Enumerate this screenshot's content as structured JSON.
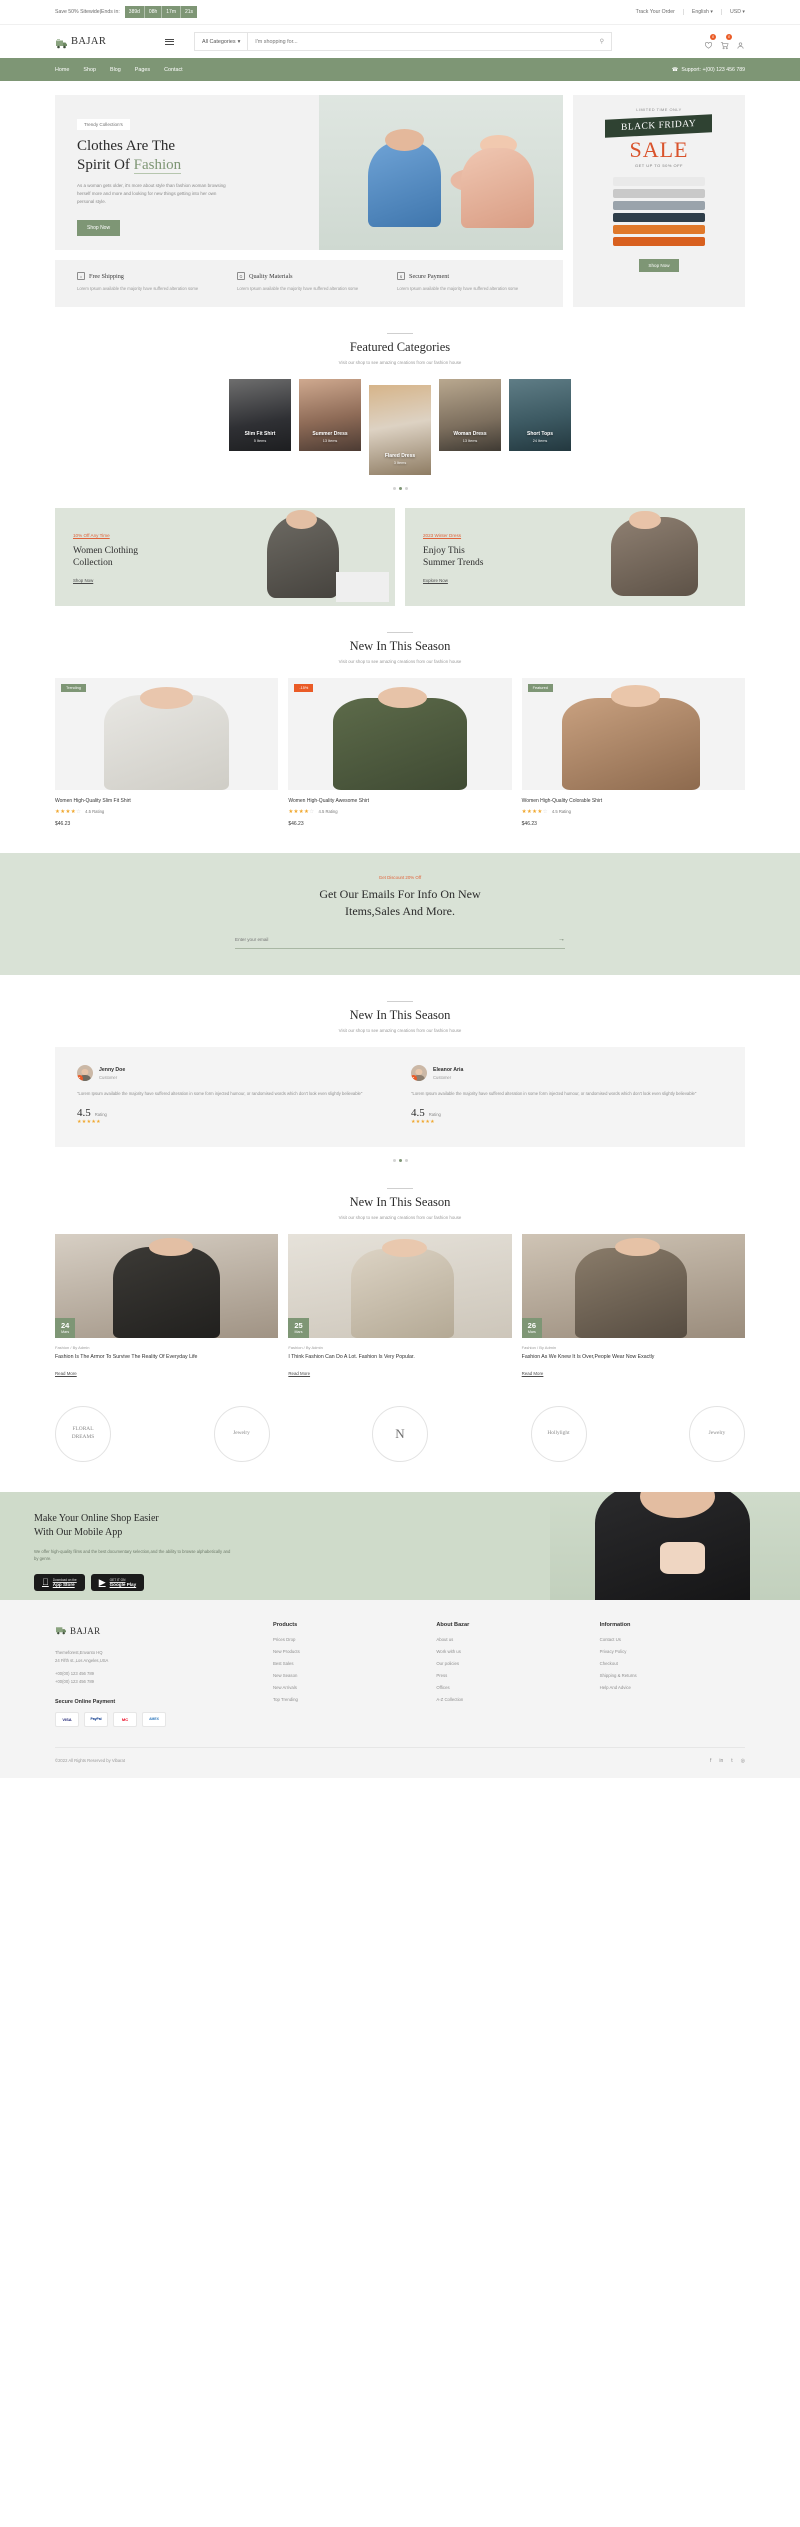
{
  "topbar": {
    "promo_text": "Save 50% Sitewide|Ends in:",
    "countdown": [
      "389d",
      "08h",
      "17m",
      "21s"
    ],
    "track": "Track Your Order",
    "language": "English",
    "currency": "USD"
  },
  "header": {
    "brand": "BAJAR",
    "category_select": "All Categories",
    "search_placeholder": "I'm shopping for...",
    "wishlist_count": "0",
    "cart_count": "0"
  },
  "nav": {
    "links": [
      "Home",
      "Shop",
      "Blog",
      "Pages",
      "Contact"
    ],
    "support": "Support: +(00) 123 456 789"
  },
  "hero": {
    "chip": "Trendy Collection's",
    "title_line1": "Clothes Are The",
    "title_line2_pre": "Spirit Of ",
    "title_line2_accent": "Fashion",
    "paragraph": "As a woman gets older, it's more about style than fashion woman browsing herself more and more and looking for new things getting into her own personal style.",
    "cta": "Shop Now"
  },
  "features": [
    {
      "icon": "bag-icon",
      "glyph": "⌂",
      "title": "Free Shipping",
      "text": "Lorem Ipsum available the majority have suffered alteration some"
    },
    {
      "icon": "tshirt-icon",
      "glyph": "⍉",
      "title": "Quality Materials",
      "text": "Lorem Ipsum available the majority have suffered alteration some"
    },
    {
      "icon": "money-icon",
      "glyph": "$",
      "title": "Secure Payment",
      "text": "Lorem Ipsum available the majority have suffered alteration some"
    }
  ],
  "side_banner": {
    "eyebrow": "LIMITED TIME ONLY",
    "band": "BLACK FRIDAY",
    "sale": "SALE",
    "sub": "GET UP TO 50% OFF",
    "cta": "Shop Now"
  },
  "categories_section": {
    "title": "Featured Categories",
    "subtitle": "Visit our shop to see amazing creations from our fashion house",
    "items": [
      {
        "name": "Slim Fit Shirt",
        "count": "5 Items"
      },
      {
        "name": "Summer Dress",
        "count": "13 Items"
      },
      {
        "name": "Flared Dress",
        "count": "3 Items"
      },
      {
        "name": "Woman Dress",
        "count": "13 Items"
      },
      {
        "name": "Short Tops",
        "count": "24 Items"
      }
    ]
  },
  "promos": [
    {
      "tag": "10% Off Any Time",
      "title_line1": "Women Clothing",
      "title_line2": "Collection",
      "link": "Shop Now"
    },
    {
      "tag": "2023 Winter Dress",
      "title_line1": "Enjoy This",
      "title_line2": "Summer Trends",
      "link": "Explore Now"
    }
  ],
  "new_season": {
    "title": "New In This Season",
    "subtitle": "Visit our shop to see amazing creations from our fashion house"
  },
  "products": [
    {
      "flag": "Trending",
      "flag_style": "green",
      "name": "Women High-Quality Slim Fit Shirt",
      "rating": "4.5 Rating",
      "price": "$46.23"
    },
    {
      "flag": "-15%",
      "flag_style": "orange",
      "name": "Women High-Quality Awesome Shirt",
      "rating": "4.5 Rating",
      "price": "$46.23"
    },
    {
      "flag": "Featured",
      "flag_style": "green",
      "name": "Women High-Quality Colorable Shirt",
      "rating": "4.5 Rating",
      "price": "$46.23"
    }
  ],
  "newsletter": {
    "tag": "Get Discount 20% Off",
    "title_line1": "Get Our Emails For Info On New",
    "title_line2": "Items,Sales And More.",
    "placeholder": "Enter your email"
  },
  "testimonials_section": {
    "title": "New In This Season",
    "subtitle": "Visit our shop to see amazing creations from our fashion house"
  },
  "testimonials": [
    {
      "name": "Jenny Doe",
      "role": "Customer",
      "text": "\"Lorem Ipsum available the majority have suffered alteration in some form injected humour, or randomised words which don't look even slightly believable\"",
      "score": "4.5",
      "score_label": "Rating"
    },
    {
      "name": "Eleanor Aria",
      "role": "Customer",
      "text": "\"Lorem Ipsum available the majority have suffered alteration in some form injected humour, or randomised words which don't look even slightly believable\"",
      "score": "4.5",
      "score_label": "Rating"
    }
  ],
  "blog_section": {
    "title": "New In This Season",
    "subtitle": "Visit our shop to see amazing creations from our fashion house"
  },
  "blogs": [
    {
      "day": "24",
      "month": "Mars",
      "meta": "Fashion / By Admin",
      "title": "Fashion Is The Armor To Survive The Reality Of Everyday Life",
      "more": "Read More"
    },
    {
      "day": "25",
      "month": "Mars",
      "meta": "Fashion / By Admin",
      "title": "I Think Fashion Can Do A Lot. Fashion Is Very Popular.",
      "more": "Read More"
    },
    {
      "day": "26",
      "month": "Mars",
      "meta": "Fashion / By Admin",
      "title": "Fashion As We Knew It Is Over,People Wear Now Exactly",
      "more": "Read More"
    }
  ],
  "brands": [
    {
      "line1": "FLORAL",
      "line2": "DREAMS"
    },
    {
      "line1": "Jewelry",
      "line2": ""
    },
    {
      "line1": "N",
      "line2": ""
    },
    {
      "line1": "Hollylight",
      "line2": ""
    },
    {
      "line1": "Jewelry",
      "line2": ""
    }
  ],
  "app_cta": {
    "title_line1": "Make Your Online Shop Easier",
    "title_line2": "With Our Mobile App",
    "text": "We offer high-quality films and the best documentary selection,and the ability to browse alphabetically and by genre.",
    "badges": [
      {
        "icon": "apple-icon",
        "glyph": "",
        "small": "Download on the",
        "big": "App Store"
      },
      {
        "icon": "play-icon",
        "glyph": "▶",
        "small": "GET IT ON",
        "big": "Google Play"
      }
    ]
  },
  "footer": {
    "brand": "BAJAR",
    "address_lines": [
      "Themeforest,Envanto HQ",
      "24 Fifth st.,Los Angeles,USA"
    ],
    "phones": [
      "+00(00) 123 456 789",
      "+00(00) 123 456 789"
    ],
    "payment_title": "Secure Online Payment",
    "cards": [
      "VISA",
      "PayPal",
      "MC",
      "AMEX"
    ],
    "columns": [
      {
        "title": "Products",
        "links": [
          "Prices Drop",
          "New Products",
          "Best Sales",
          "New Season",
          "New Arrivals",
          "Top Trending"
        ]
      },
      {
        "title": "About Bazar",
        "links": [
          "About us",
          "Work with us",
          "Our policies",
          "Press",
          "Offices",
          "A-Z Collection"
        ]
      },
      {
        "title": "Information",
        "links": [
          "Contact Us",
          "Privacy Policy",
          "Checkout",
          "Shipping & Returns",
          "Help And Advice"
        ]
      }
    ],
    "copyright": "©2022 All Rights Reserved by Vibarat",
    "socials": [
      "f",
      "in",
      "t",
      "◎"
    ]
  }
}
